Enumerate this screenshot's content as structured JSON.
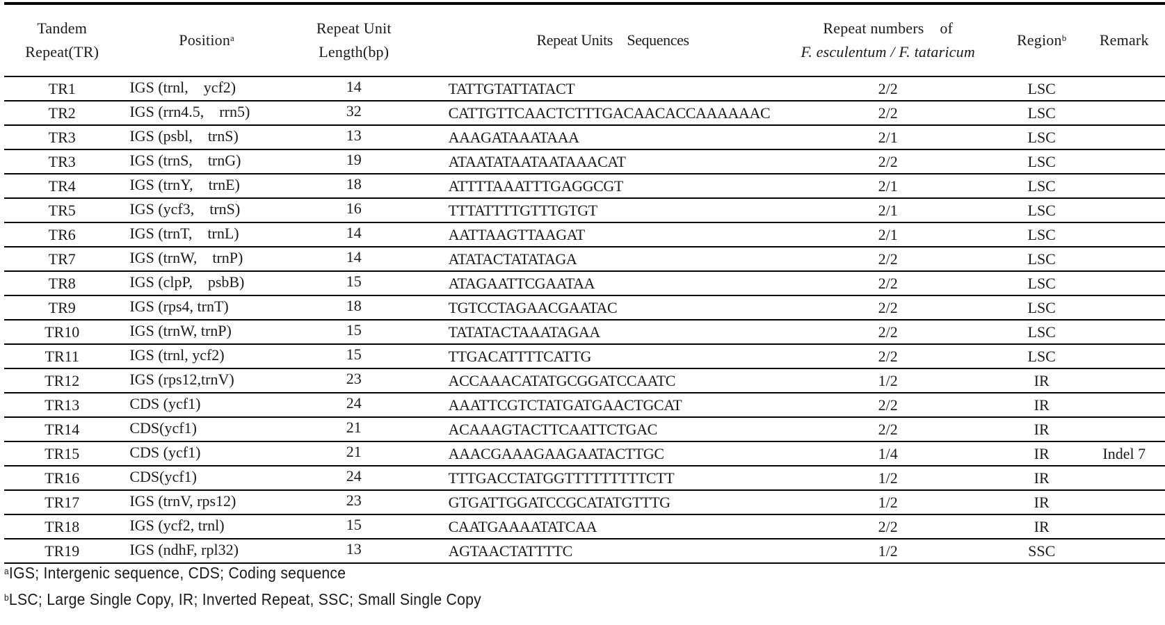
{
  "table": {
    "headers": {
      "tr_line1": "Tandem",
      "tr_line2": "Repeat(TR)",
      "position": "Position",
      "position_sup": "a",
      "length_line1": "Repeat Unit",
      "length_line2": "Length(bp)",
      "sequence": "Repeat Units    Sequences",
      "repeat_line1": "Repeat numbers    of",
      "repeat_line2": "F. esculentum / F. tataricum",
      "region": "Region",
      "region_sup": "b",
      "remark": "Remark"
    },
    "rows": [
      {
        "tr": "TR1",
        "position": "IGS (trnl,    ycf2)",
        "length": "14",
        "sequence": "TATTGTATTATACT",
        "repeats": "2/2",
        "region": "LSC",
        "remark": ""
      },
      {
        "tr": "TR2",
        "position": "IGS (rrn4.5,    rrn5)",
        "length": "32",
        "sequence": "CATTGTTCAACTCTTTGACAACACCAAAAAAC",
        "repeats": "2/2",
        "region": "LSC",
        "remark": ""
      },
      {
        "tr": "TR3",
        "position": "IGS (psbl,    trnS)",
        "length": "13",
        "sequence": "AAAGATAAATAAA",
        "repeats": "2/1",
        "region": "LSC",
        "remark": ""
      },
      {
        "tr": "TR3",
        "position": "IGS (trnS,    trnG)",
        "length": "19",
        "sequence": "ATAATATAATAATAAACAT",
        "repeats": "2/2",
        "region": "LSC",
        "remark": ""
      },
      {
        "tr": "TR4",
        "position": "IGS (trnY,    trnE)",
        "length": "18",
        "sequence": "ATTTTAAATTTGAGGCGT",
        "repeats": "2/1",
        "region": "LSC",
        "remark": ""
      },
      {
        "tr": "TR5",
        "position": "IGS (ycf3,    trnS)",
        "length": "16",
        "sequence": "TTTATTTTGTTTGTGT",
        "repeats": "2/1",
        "region": "LSC",
        "remark": ""
      },
      {
        "tr": "TR6",
        "position": "IGS (trnT,    trnL)",
        "length": "14",
        "sequence": "AATTAAGTTAAGAT",
        "repeats": "2/1",
        "region": "LSC",
        "remark": ""
      },
      {
        "tr": "TR7",
        "position": "IGS (trnW,    trnP)",
        "length": "14",
        "sequence": "ATATACTATATAGA",
        "repeats": "2/2",
        "region": "LSC",
        "remark": ""
      },
      {
        "tr": "TR8",
        "position": "IGS (clpP,    psbB)",
        "length": "15",
        "sequence": "ATAGAATTCGAATAA",
        "repeats": "2/2",
        "region": "LSC",
        "remark": ""
      },
      {
        "tr": "TR9",
        "position": "IGS (rps4, trnT)",
        "length": "18",
        "sequence": "TGTCCTAGAACGAATAC",
        "repeats": "2/2",
        "region": "LSC",
        "remark": ""
      },
      {
        "tr": "TR10",
        "position": "IGS (trnW, trnP)",
        "length": "15",
        "sequence": "TATATACTAAATAGAA",
        "repeats": "2/2",
        "region": "LSC",
        "remark": ""
      },
      {
        "tr": "TR11",
        "position": "IGS (trnl, ycf2)",
        "length": "15",
        "sequence": "TTGACATTTTCATTG",
        "repeats": "2/2",
        "region": "LSC",
        "remark": ""
      },
      {
        "tr": "TR12",
        "position": "IGS (rps12,trnV)",
        "length": "23",
        "sequence": "ACCAAACATATGCGGATCCAATC",
        "repeats": "1/2",
        "region": "IR",
        "remark": ""
      },
      {
        "tr": "TR13",
        "position": "CDS (ycf1)",
        "length": "24",
        "sequence": "AAATTCGTCTATGATGAACTGCAT",
        "repeats": "2/2",
        "region": "IR",
        "remark": ""
      },
      {
        "tr": "TR14",
        "position": "CDS(ycf1)",
        "length": "21",
        "sequence": "ACAAAGTACTTCAATTCTGAC",
        "repeats": "2/2",
        "region": "IR",
        "remark": ""
      },
      {
        "tr": "TR15",
        "position": "CDS (ycf1)",
        "length": "21",
        "sequence": "AAACGAAAGAAGAATACTTGC",
        "repeats": "1/4",
        "region": "IR",
        "remark": "Indel 7"
      },
      {
        "tr": "TR16",
        "position": "CDS(ycf1)",
        "length": "24",
        "sequence": "TTTGACCTATGGTTTTTTTTTCTT",
        "repeats": "1/2",
        "region": "IR",
        "remark": ""
      },
      {
        "tr": "TR17",
        "position": "IGS (trnV, rps12)",
        "length": "23",
        "sequence": "GTGATTGGATCCGCATATGTTTG",
        "repeats": "1/2",
        "region": "IR",
        "remark": ""
      },
      {
        "tr": "TR18",
        "position": "IGS (ycf2, trnl)",
        "length": "15",
        "sequence": "CAATGAAAATATCAA",
        "repeats": "2/2",
        "region": "IR",
        "remark": ""
      },
      {
        "tr": "TR19",
        "position": "IGS (ndhF, rpl32)",
        "length": "13",
        "sequence": "AGTAACTATTTTC",
        "repeats": "1/2",
        "region": "SSC",
        "remark": ""
      }
    ]
  },
  "footnotes": [
    {
      "marker": "a",
      "text": "IGS; Intergenic sequence, CDS; Coding sequence"
    },
    {
      "marker": "b",
      "text": "LSC; Large Single Copy, IR; Inverted Repeat, SSC; Small Single Copy"
    }
  ]
}
